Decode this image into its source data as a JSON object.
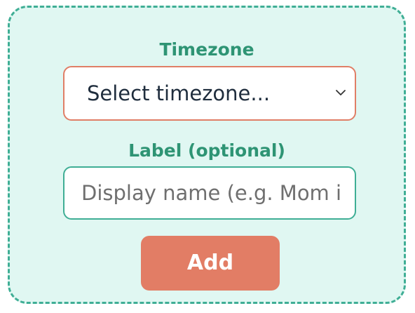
{
  "form": {
    "timezone_label": "Timezone",
    "timezone_select_value": "Select timezone...",
    "label_label": "Label (optional)",
    "label_input_placeholder": "Display name (e.g. Mom i",
    "add_button_label": "Add"
  },
  "icons": {
    "select_chevron": "chevron-down-icon"
  },
  "colors": {
    "card_background": "#e0f7f2",
    "card_border": "#3fae95",
    "label_text": "#2e9474",
    "select_border": "#e07e66",
    "input_border": "#3fae95",
    "button_background": "#e27d65",
    "button_text": "#ffffff"
  }
}
